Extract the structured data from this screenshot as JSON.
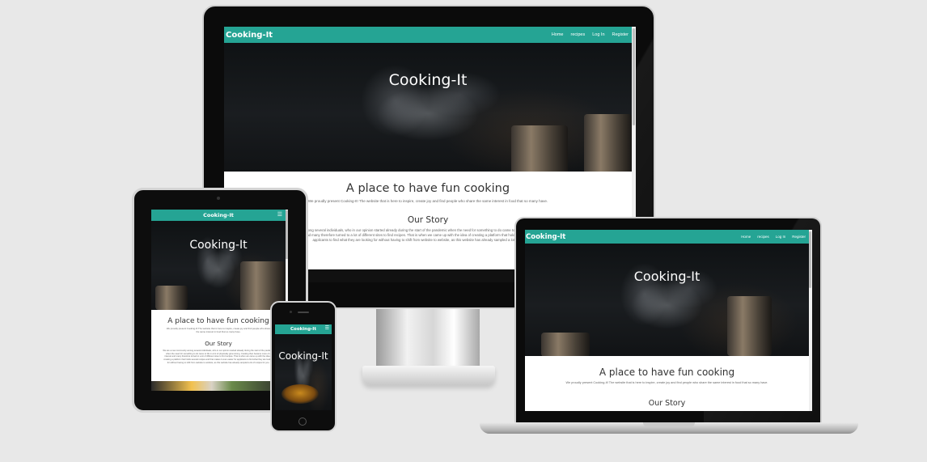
{
  "site": {
    "brand": "Cooking-It",
    "nav": [
      "Home",
      "recipes",
      "Log In",
      "Register"
    ],
    "hero_title": "Cooking-It",
    "tagline": "A place to have fun cooking",
    "intro": "We proudly present Cooking-It! The website that is here to inspire, create joy and find people who share the same interest in food that so many have.",
    "story_heading": "Our Story",
    "story_text": "We are a new community among several individuals, who in our opinion started already during the start of the pandemic when the need for something to do came to life in a lot of physically grew strong. Cooking then became more of a interest and many therefore turned to a lot of different sites to find recipes. That is when we came up with the idea of creating a platform that holds several recipes and that makes it even easier for applicants to find what they are looking for without having to shift from website to website, as this website has already sampled a lot of recipes for you.",
    "menu_icon": "hamburger-menu-icon",
    "theme_color": "#25a494"
  }
}
